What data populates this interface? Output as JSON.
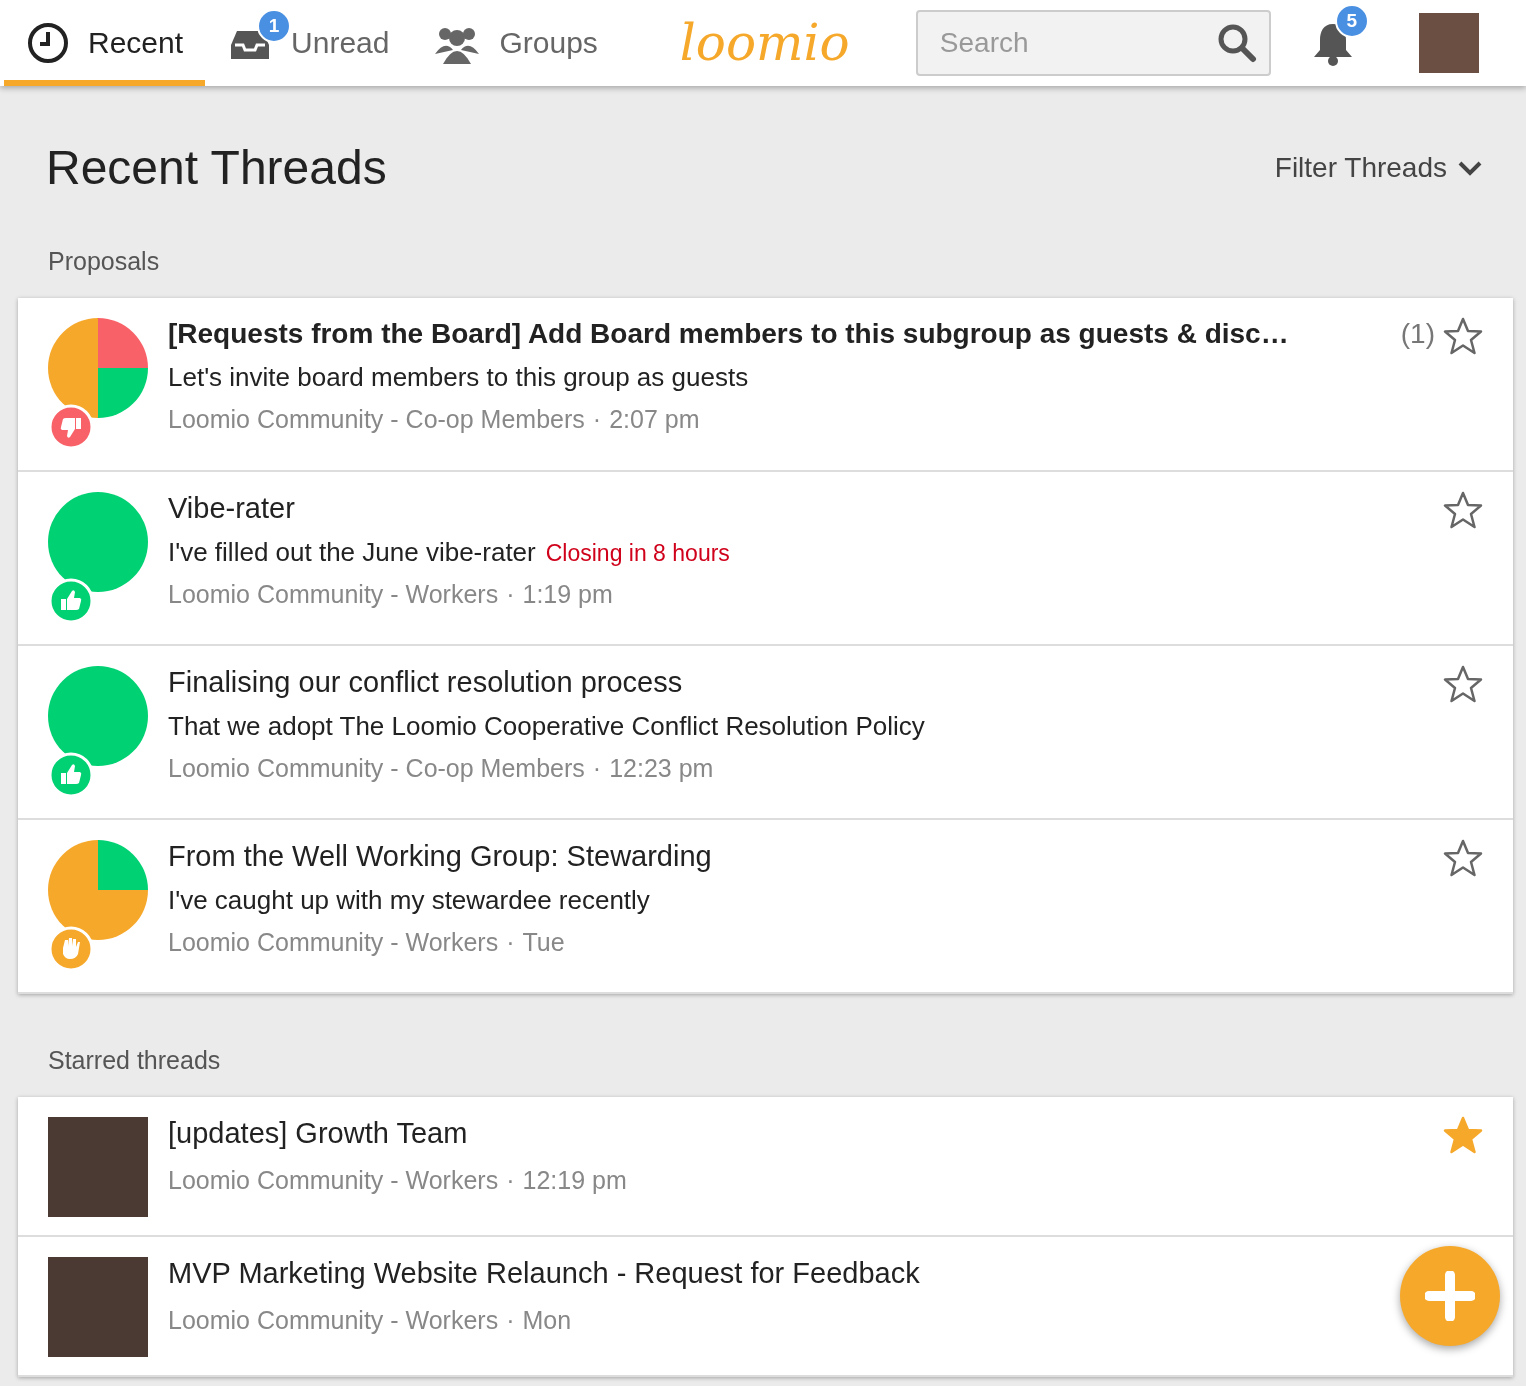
{
  "nav": {
    "tabs": [
      {
        "kind": "recent",
        "label": "Recent",
        "selected": true
      },
      {
        "kind": "unread",
        "label": "Unread",
        "badge": "1",
        "selected": false
      },
      {
        "kind": "groups",
        "label": "Groups",
        "selected": false
      }
    ],
    "logo": "loomio",
    "search": {
      "placeholder": "Search"
    },
    "notifications": "5"
  },
  "page_title": "Recent Threads",
  "filter": "Filter Threads",
  "sections": [
    {
      "heading": "Proposals",
      "threads": [
        {
          "kind": "proposal",
          "title": "[Requests from the Board] Add Board members to this subgroup as guests & disc…",
          "unread": true,
          "count": "(1)",
          "pie_slices": [
            {
              "color": "#f96168"
            },
            {
              "color": "#00d173"
            },
            {
              "color": "#f6a82b"
            },
            {
              "color": "#f6a82b"
            }
          ],
          "position_badge": {
            "kind": "disagree",
            "color": "#f96168"
          },
          "summary": "Let's invite board members to this group as guests",
          "group": "Loomio Community - Co-op Members",
          "separator": "·",
          "time": "2:07 pm",
          "starred": false
        },
        {
          "kind": "proposal",
          "title": "Vibe-rater",
          "unread": false,
          "pie_slices": [
            {
              "color": "#00d173"
            },
            {
              "color": "#00d173"
            },
            {
              "color": "#00d173"
            },
            {
              "color": "#00d173"
            }
          ],
          "position_badge": {
            "kind": "agree",
            "color": "#00d173"
          },
          "summary": "I've filled out the June vibe-rater",
          "closing": "Closing in 8 hours",
          "group": "Loomio Community - Workers",
          "separator": "·",
          "time": "1:19 pm",
          "starred": false
        },
        {
          "kind": "proposal",
          "title": "Finalising our conflict resolution process",
          "unread": false,
          "pie_slices": [
            {
              "color": "#00d173"
            },
            {
              "color": "#00d173"
            },
            {
              "color": "#00d173"
            },
            {
              "color": "#00d173"
            }
          ],
          "position_badge": {
            "kind": "agree",
            "color": "#00d173"
          },
          "summary": "That we adopt The Loomio Cooperative Conflict Resolution Policy",
          "group": "Loomio Community - Co-op Members",
          "separator": "·",
          "time": "12:23 pm",
          "starred": false
        },
        {
          "kind": "proposal",
          "title": "From the Well Working Group: Stewarding",
          "unread": false,
          "pie_slices": [
            {
              "color": "#00d173"
            },
            {
              "color": "#f6a82b"
            },
            {
              "color": "#f6a82b"
            },
            {
              "color": "#f6a82b"
            }
          ],
          "position_badge": {
            "kind": "abstain",
            "color": "#f6a82b"
          },
          "summary": "I've caught up with my stewardee recently",
          "group": "Loomio Community - Workers",
          "separator": "·",
          "time": "Tue",
          "starred": false
        }
      ]
    },
    {
      "heading": "Starred threads",
      "threads": [
        {
          "kind": "discussion",
          "title": "[updates] Growth Team",
          "unread": false,
          "group": "Loomio Community - Workers",
          "separator": "·",
          "time": "12:19 pm",
          "starred": true
        },
        {
          "kind": "discussion",
          "title": "MVP Marketing Website Relaunch - Request for Feedback",
          "unread": false,
          "group": "Loomio Community - Workers",
          "separator": "·",
          "time": "Mon"
        }
      ]
    }
  ]
}
